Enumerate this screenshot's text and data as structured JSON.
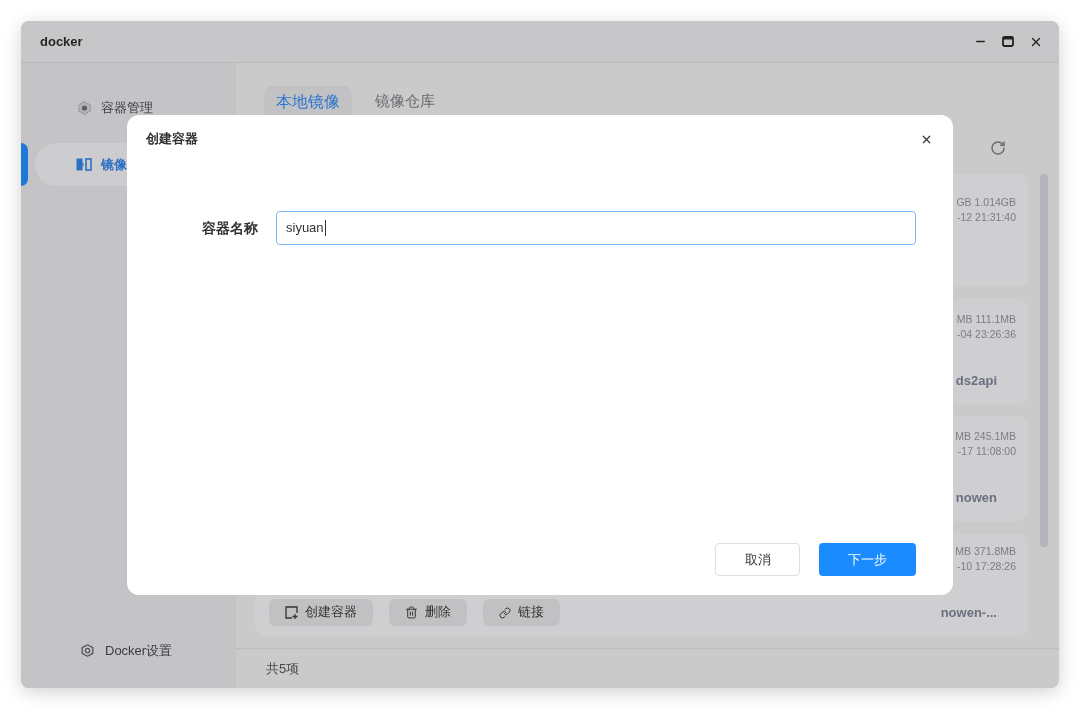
{
  "window": {
    "title": "docker"
  },
  "sidebar": {
    "items": [
      {
        "label": "容器管理",
        "selected": false
      },
      {
        "label": "镜像",
        "selected": true
      }
    ],
    "footer_item": {
      "label": "Docker设置"
    }
  },
  "tabs": [
    {
      "label": "本地镜像",
      "selected": true
    },
    {
      "label": "镜像仓库",
      "selected": false
    }
  ],
  "image_cards": [
    {
      "line_1": "GB 1.014GB",
      "line_2": "-12 21:31:40"
    },
    {
      "line_1": "MB 111.1MB",
      "line_2": "-04 23:26:36",
      "name": "ds2api"
    },
    {
      "line_1": "MB 245.1MB",
      "line_2": "-17 11:08:00",
      "name": "nowen"
    },
    {
      "line_1": "MB 371.8MB",
      "line_2": "-10 17:28:26",
      "name": "nowen-...",
      "actions": [
        {
          "label": "创建容器",
          "kind": "create"
        },
        {
          "label": "删除",
          "kind": "delete"
        },
        {
          "label": "链接",
          "kind": "link"
        }
      ]
    }
  ],
  "status_bar": {
    "count": "共5项"
  },
  "dialog": {
    "title": "创建容器",
    "field": {
      "label": "容器名称",
      "value": "siyuan"
    },
    "buttons": [
      {
        "label": "取消",
        "kind": "secondary"
      },
      {
        "label": "下一步",
        "kind": "primary"
      }
    ]
  }
}
